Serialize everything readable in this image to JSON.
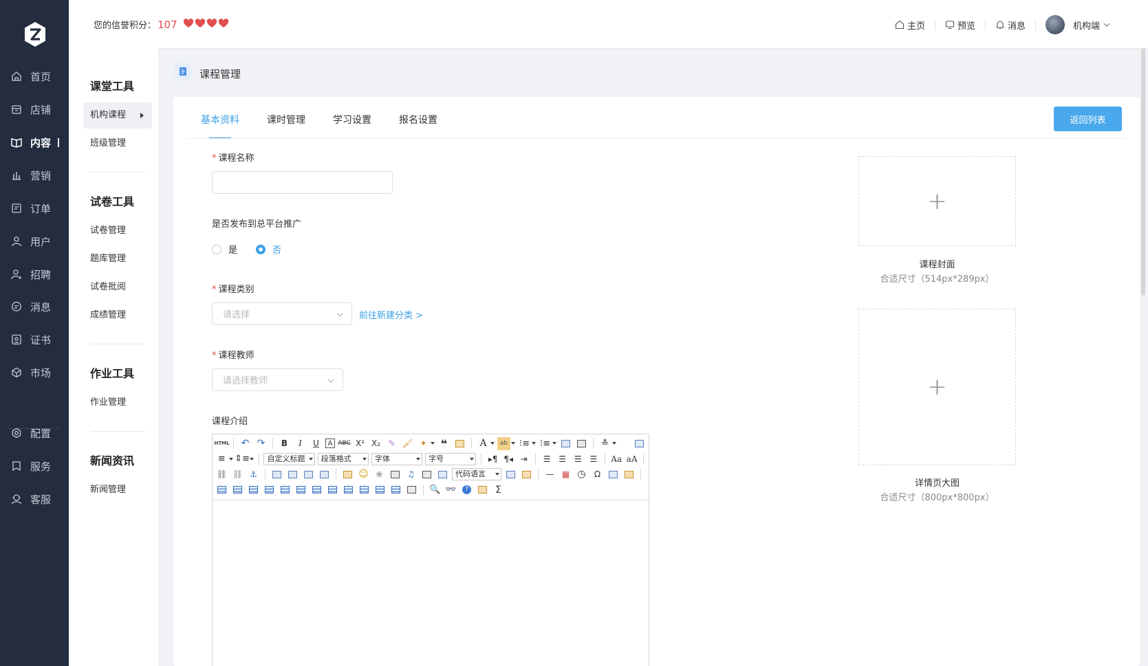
{
  "nav": {
    "items": [
      {
        "label": "首页",
        "icon": "home-icon"
      },
      {
        "label": "店铺",
        "icon": "shop-icon"
      },
      {
        "label": "内容",
        "icon": "book-icon",
        "active": true
      },
      {
        "label": "营销",
        "icon": "chart-icon"
      },
      {
        "label": "订单",
        "icon": "order-icon"
      },
      {
        "label": "用户",
        "icon": "user-icon"
      },
      {
        "label": "招聘",
        "icon": "recruit-icon"
      },
      {
        "label": "消息",
        "icon": "message-icon"
      },
      {
        "label": "证书",
        "icon": "certificate-icon"
      },
      {
        "label": "市场",
        "icon": "market-icon"
      },
      {
        "label": "配置",
        "icon": "gear-icon"
      },
      {
        "label": "服务",
        "icon": "service-icon"
      },
      {
        "label": "客服",
        "icon": "support-icon"
      }
    ]
  },
  "header": {
    "credit_label": "您的信誉积分：",
    "credit_score": "107",
    "hearts": 4,
    "links": [
      "主页",
      "预览",
      "消息"
    ],
    "user_name": "机构端"
  },
  "subnav": {
    "sections": [
      {
        "title": "课堂工具",
        "items": [
          "机构课程",
          "班级管理"
        ]
      },
      {
        "title": "试卷工具",
        "items": [
          "试卷管理",
          "题库管理",
          "试卷批阅",
          "成绩管理"
        ]
      },
      {
        "title": "作业工具",
        "items": [
          "作业管理"
        ]
      },
      {
        "title": "新闻资讯",
        "items": [
          "新闻管理"
        ]
      }
    ]
  },
  "breadcrumb": "课程管理",
  "tabs": [
    "基本资料",
    "课时管理",
    "学习设置",
    "报名设置"
  ],
  "back_button": "返回列表",
  "form": {
    "course_name_label": "课程名称",
    "publish_label": "是否发布到总平台推广",
    "publish_options": [
      "是",
      "否"
    ],
    "publish_selected": "否",
    "category_label": "课程类别",
    "category_placeholder": "请选择",
    "category_link": "前往新建分类 >",
    "teacher_label": "课程教师",
    "teacher_placeholder": "请选择教师",
    "intro_label": "课程介绍"
  },
  "editor": {
    "selects": [
      "自定义标题",
      "段落格式",
      "字体",
      "字号",
      "代码语言"
    ]
  },
  "uploads": [
    {
      "title": "课程封面",
      "hint": "合适尺寸（514px*289px）"
    },
    {
      "title": "详情页大图",
      "hint": "合适尺寸（800px*800px）"
    }
  ],
  "colors": {
    "nav_bg": "#232d3f",
    "accent": "#3a9ee8",
    "button": "#4aa9ec",
    "score": "#e24d4d"
  }
}
